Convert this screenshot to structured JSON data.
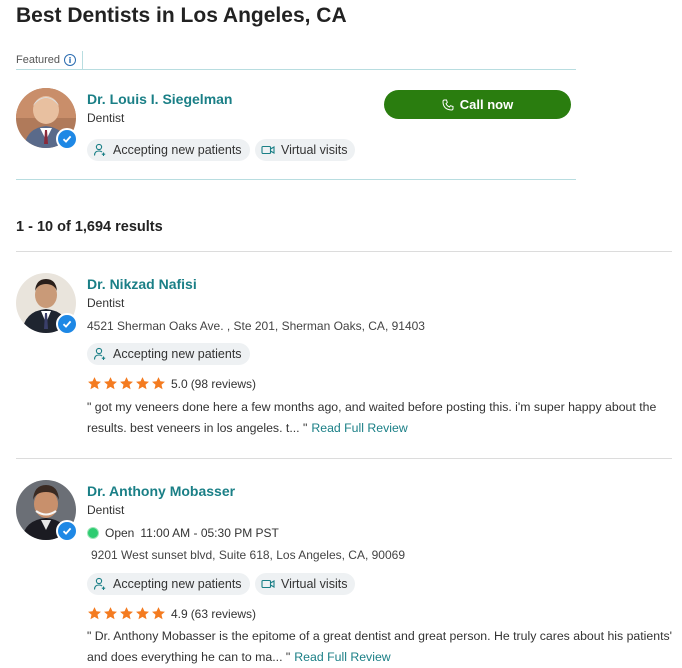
{
  "page": {
    "title": "Best Dentists in Los Angeles, CA"
  },
  "featured": {
    "label": "Featured",
    "info_icon": "info-icon",
    "doctor": {
      "name": "Dr. Louis I. Siegelman",
      "specialty": "Dentist",
      "badges": [
        "Accepting new patients",
        "Virtual visits"
      ],
      "call_label": "Call now"
    }
  },
  "results": {
    "summary": "1 - 10 of 1,694 results"
  },
  "listings": [
    {
      "name": "Dr. Nikzad Nafisi",
      "specialty": "Dentist",
      "address": "4521 Sherman Oaks Ave. , Ste 201, Sherman Oaks, CA, 91403",
      "badges": [
        "Accepting new patients"
      ],
      "rating": "5.0",
      "stars": 5,
      "reviews": "(98 reviews)",
      "review_text": "\" got my veneers done here a few months ago, and waited before posting this. i'm super happy about the results. best veneers in los angeles. t... \"",
      "review_link": "Read Full Review"
    },
    {
      "name": "Dr. Anthony Mobasser",
      "specialty": "Dentist",
      "open_status": "Open",
      "hours": "11:00 AM - 05:30 PM PST",
      "address": "9201 West sunset blvd, Suite 618, Los Angeles, CA, 90069",
      "badges": [
        "Accepting new patients",
        "Virtual visits"
      ],
      "rating": "4.9",
      "stars": 5,
      "reviews": "(63 reviews)",
      "review_text": "\" Dr. Anthony Mobasser is the epitome of a great dentist and great person. He truly cares about his patients' and does everything he can to ma... \"",
      "review_link": "Read Full Review"
    }
  ],
  "colors": {
    "accent_teal": "#1a7f86",
    "call_green": "#2a7d0f",
    "star_orange": "#f47b20",
    "verified_blue": "#1e88e5",
    "open_green": "#2ecc71"
  }
}
